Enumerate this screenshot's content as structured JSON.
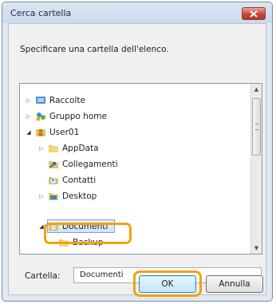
{
  "window": {
    "title": "Cerca cartella"
  },
  "instruction": "Specificare una cartella dell'elenco.",
  "tree": {
    "items": [
      {
        "label": "Raccolte",
        "expander": "collapsed",
        "icon": "library-icon"
      },
      {
        "label": "Gruppo home",
        "expander": "collapsed",
        "icon": "homegroup-icon"
      },
      {
        "label": "User01",
        "expander": "expanded",
        "icon": "user-folder-icon"
      },
      {
        "label": "AppData",
        "expander": "collapsed",
        "icon": "folder-icon"
      },
      {
        "label": "Collegamenti",
        "expander": "none",
        "icon": "links-folder-icon"
      },
      {
        "label": "Contatti",
        "expander": "none",
        "icon": "contacts-folder-icon"
      },
      {
        "label": "Desktop",
        "expander": "collapsed",
        "icon": "desktop-folder-icon"
      },
      {
        "label": "Documenti",
        "expander": "expanded",
        "icon": "documents-folder-icon",
        "selected": true
      },
      {
        "label": "Backup",
        "expander": "none",
        "icon": "folder-icon"
      }
    ]
  },
  "folder_field": {
    "label": "Cartella:",
    "value": "Documenti"
  },
  "buttons": {
    "ok": "OK",
    "cancel": "Annulla"
  },
  "colors": {
    "highlight": "#f2a20c",
    "titlebar": "#cad9eb",
    "close": "#c7453a"
  }
}
